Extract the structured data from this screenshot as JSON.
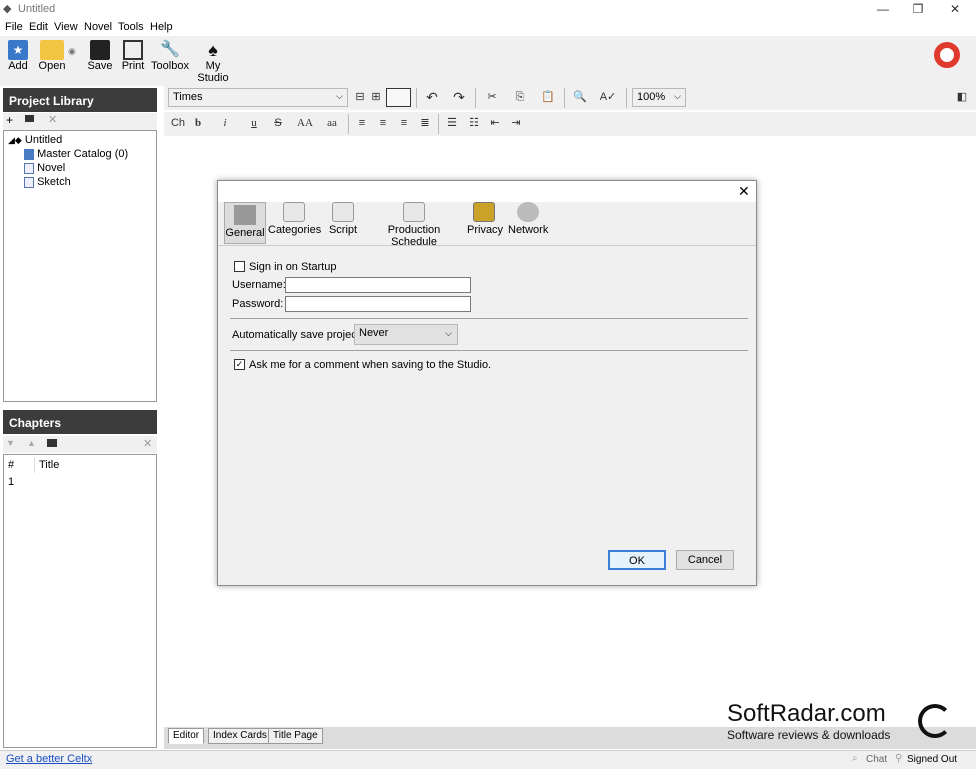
{
  "window": {
    "title": "Untitled",
    "min": "—",
    "restore": "❐",
    "close": "✕"
  },
  "menu": [
    "File",
    "Edit",
    "View",
    "Novel",
    "Tools",
    "Help"
  ],
  "toolbar": {
    "add": "Add",
    "open": "Open",
    "save": "Save",
    "print": "Print",
    "toolbox": "Toolbox",
    "my_studio": "My Studio"
  },
  "project_library": {
    "title": "Project Library",
    "tree": [
      {
        "label": "Untitled"
      },
      {
        "label": "Master Catalog (0)"
      },
      {
        "label": "Novel"
      },
      {
        "label": "Sketch"
      }
    ]
  },
  "chapters": {
    "title": "Chapters",
    "columns": [
      "#",
      "Title"
    ],
    "rows": [
      {
        "num": "1",
        "title": ""
      }
    ]
  },
  "format": {
    "font": "Times",
    "zoom": "100%",
    "styles": [
      "Ch",
      "b",
      "i",
      "u",
      "S",
      "AA",
      "aa"
    ]
  },
  "dialog": {
    "tabs": [
      "General",
      "Categories",
      "Script",
      "Production Schedule",
      "Privacy",
      "Network"
    ],
    "signin_label": "Sign in on Startup",
    "username_label": "Username:",
    "password_label": "Password:",
    "username_value": "",
    "password_value": "",
    "autosave_label": "Automatically save project:",
    "autosave_value": "Never",
    "comment_label": "Ask me for a comment when saving to the Studio.",
    "signin_checked": false,
    "comment_checked": true,
    "ok": "OK",
    "cancel": "Cancel"
  },
  "bottom_tabs": [
    "Editor",
    "Index Cards",
    "Title Page"
  ],
  "status": {
    "link": "Get a better Celtx",
    "chat": "Chat",
    "signed": "Signed Out"
  },
  "watermark": {
    "brand": "SoftRadar.com",
    "tagline": "Software reviews & downloads"
  }
}
